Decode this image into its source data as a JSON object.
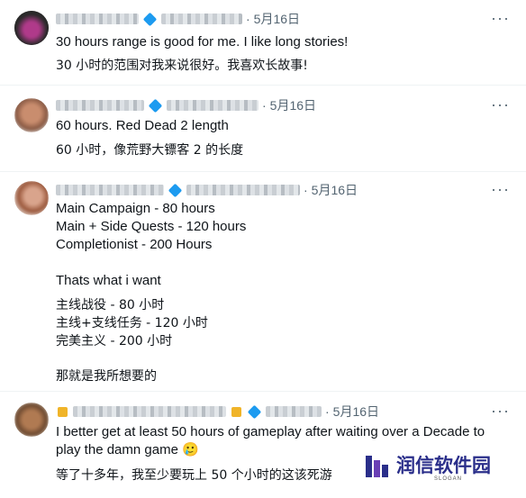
{
  "tweets": [
    {
      "date": "5月16日",
      "separator": "·",
      "more": "···",
      "lines": [
        "30 hours range is good for me. I like long stories!",
        "30 小时的范围对我来说很好。我喜欢长故事!"
      ]
    },
    {
      "date": "5月16日",
      "separator": "·",
      "more": "···",
      "lines": [
        "60 hours. Red Dead 2 length",
        "60 小时，像荒野大镖客 2 的长度"
      ]
    },
    {
      "date": "5月16日",
      "separator": "·",
      "more": "···",
      "lines": [
        "Main Campaign - 80 hours",
        "Main + Side Quests - 120 hours",
        "Completionist  - 200 Hours",
        "Thats what i want",
        "主线战役 - 80 小时",
        "主线+支线任务 - 120 小时",
        "完美主义 - 200 小时",
        "那就是我所想要的"
      ]
    },
    {
      "date": "5月16日",
      "separator": "·",
      "more": "···",
      "lines": [
        "I better get at least 50 hours of gameplay after waiting over a Decade to",
        "play the damn game 🥲",
        "等了十多年，我至少要玩上 50 个小时的这该死游"
      ]
    }
  ],
  "watermark": {
    "name": "润信软件园",
    "slogan": "SLOGAN"
  },
  "colors": {
    "text": "#0f1419",
    "secondary": "#536471",
    "verified": "#1d9bf0",
    "logo": "#2a2e8a"
  }
}
